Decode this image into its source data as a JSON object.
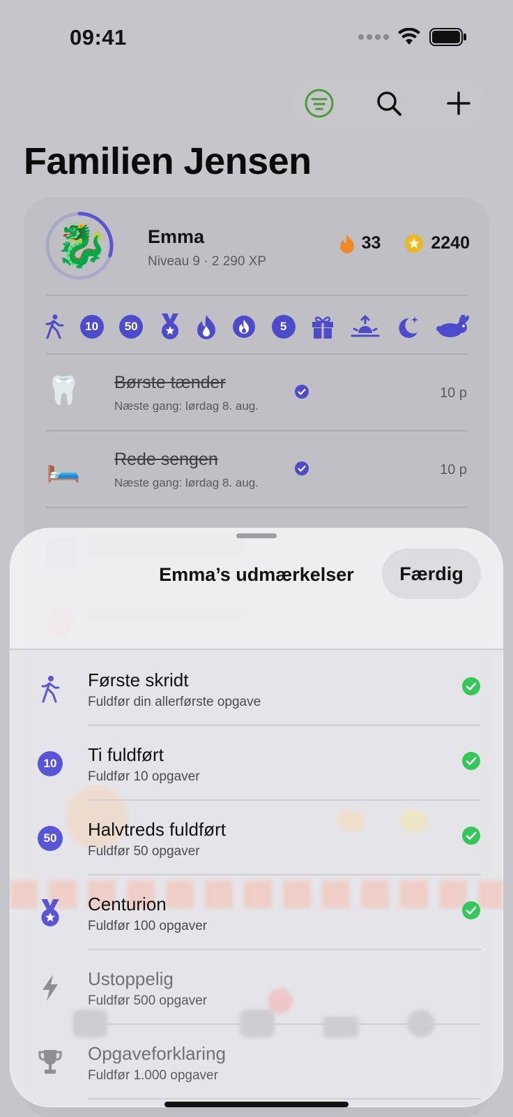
{
  "status": {
    "time": "09:41"
  },
  "page": {
    "title": "Familien Jensen"
  },
  "profile": {
    "name": "Emma",
    "level": "Niveau 9 · 2 290 XP",
    "avatar": "🐉",
    "level_progress": 0.3,
    "streak": "33",
    "coins": "2240"
  },
  "badges": [
    {
      "icon": "walking-icon"
    },
    {
      "label": "10"
    },
    {
      "label": "50"
    },
    {
      "icon": "medal-icon"
    },
    {
      "icon": "flame-icon"
    },
    {
      "icon": "flame-circle-icon"
    },
    {
      "label": "5"
    },
    {
      "icon": "gift-icon"
    },
    {
      "icon": "sunrise-icon"
    },
    {
      "icon": "moon-stars-icon"
    },
    {
      "icon": "rabbit-icon"
    }
  ],
  "tasks": [
    {
      "emoji": "🦷",
      "name": "Børste tænder",
      "next": "Næste gang: lørdag 8. aug.",
      "points": "10 p"
    },
    {
      "emoji": "🛏️",
      "name": "Rede sengen",
      "next": "Næste gang: lørdag 8. aug.",
      "points": "10 p"
    }
  ],
  "sheet": {
    "title": "Emma’s udmærkelser",
    "done": "Færdig",
    "achievements": [
      {
        "icon": "walking-icon",
        "name": "Første skridt",
        "desc": "Fuldfør din allerførste opgave",
        "unlocked": true
      },
      {
        "icon": "badge-10-icon",
        "badge": "10",
        "name": "Ti fuldført",
        "desc": "Fuldfør 10 opgaver",
        "unlocked": true
      },
      {
        "icon": "badge-50-icon",
        "badge": "50",
        "name": "Halvtreds fuldført",
        "desc": "Fuldfør 50 opgaver",
        "unlocked": true
      },
      {
        "icon": "medal-icon",
        "name": "Centurion",
        "desc": "Fuldfør 100 opgaver",
        "unlocked": true
      },
      {
        "icon": "bolt-icon",
        "name": "Ustoppelig",
        "desc": "Fuldfør 500 opgaver",
        "unlocked": false
      },
      {
        "icon": "trophy-icon",
        "name": "Opgaveforklaring",
        "desc": "Fuldfør 1.000 opgaver",
        "unlocked": false
      }
    ]
  },
  "colors": {
    "accent": "#5856d6",
    "success": "#34c759",
    "flame": "#f08a24",
    "coin": "#f5c518",
    "filter": "#4caf50"
  }
}
